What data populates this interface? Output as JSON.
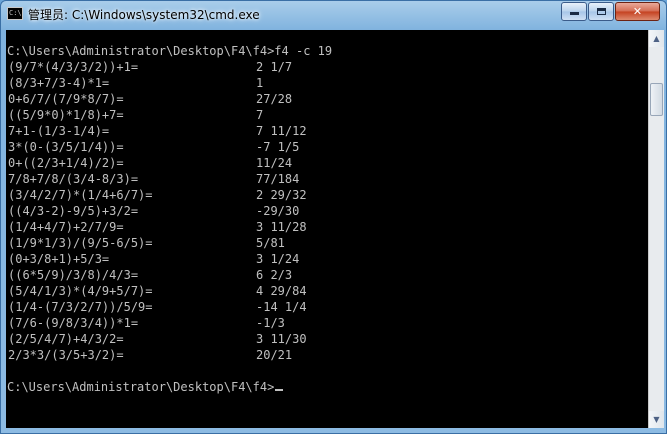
{
  "window": {
    "title": "管理员: C:\\Windows\\system32\\cmd.exe",
    "icon": "cmd-icon",
    "icon_text": "C:\\"
  },
  "controls": {
    "minimize_icon": "minimize-icon",
    "maximize_icon": "maximize-icon",
    "close_icon": "close-icon",
    "close_glyph": "✕"
  },
  "console": {
    "text_color": "#c0c0c0",
    "background": "#000000",
    "command_line": "C:\\Users\\Administrator\\Desktop\\F4\\f4>f4 -c 19",
    "rows": [
      {
        "expr": "(9/7*(4/3/3/2))+1=",
        "result": "2 1/7"
      },
      {
        "expr": "(8/3+7/3-4)*1=",
        "result": "1"
      },
      {
        "expr": "0+6/7/(7/9*8/7)=",
        "result": "27/28"
      },
      {
        "expr": "((5/9*0)*1/8)+7=",
        "result": "7"
      },
      {
        "expr": "7+1-(1/3-1/4)=",
        "result": "7 11/12"
      },
      {
        "expr": "3*(0-(3/5/1/4))=",
        "result": "-7 1/5"
      },
      {
        "expr": "0+((2/3+1/4)/2)=",
        "result": "11/24"
      },
      {
        "expr": "7/8+7/8/(3/4-8/3)=",
        "result": "77/184"
      },
      {
        "expr": "(3/4/2/7)*(1/4+6/7)=",
        "result": "2 29/32"
      },
      {
        "expr": "((4/3-2)-9/5)+3/2=",
        "result": "-29/30"
      },
      {
        "expr": "(1/4+4/7)+2/7/9=",
        "result": "3 11/28"
      },
      {
        "expr": "(1/9*1/3)/(9/5-6/5)=",
        "result": "5/81"
      },
      {
        "expr": "(0+3/8+1)+5/3=",
        "result": "3 1/24"
      },
      {
        "expr": "((6*5/9)/3/8)/4/3=",
        "result": "6 2/3"
      },
      {
        "expr": "(5/4/1/3)*(4/9+5/7)=",
        "result": "4 29/84"
      },
      {
        "expr": "(1/4-(7/3/2/7))/5/9=",
        "result": "-14 1/4"
      },
      {
        "expr": "(7/6-(9/8/3/4))*1=",
        "result": "-1/3"
      },
      {
        "expr": "(2/5/4/7)+4/3/2=",
        "result": "3 11/30"
      },
      {
        "expr": "2/3*3/(3/5+3/2)=",
        "result": "20/21"
      }
    ],
    "prompt": "C:\\Users\\Administrator\\Desktop\\F4\\f4>"
  },
  "scrollbar": {
    "up_icon": "scroll-up-arrow-icon",
    "down_icon": "scroll-down-arrow-icon",
    "up_glyph": "▲",
    "down_glyph": "▼"
  }
}
